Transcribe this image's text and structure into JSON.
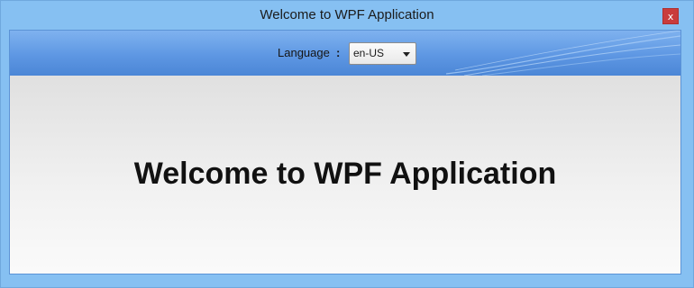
{
  "window": {
    "title": "Welcome to WPF Application",
    "close_label": "x"
  },
  "header": {
    "language_label": "Language",
    "language_separator": ":",
    "language_selected": "en-US"
  },
  "main": {
    "welcome_text": "Welcome to WPF Application"
  },
  "colors": {
    "frame": "#86c0f2",
    "header_band": "#5e97e3",
    "close_button": "#c93c3c",
    "content_background": "#eeeeee"
  },
  "icons": {
    "close": "close-icon",
    "dropdown": "chevron-down-icon"
  }
}
